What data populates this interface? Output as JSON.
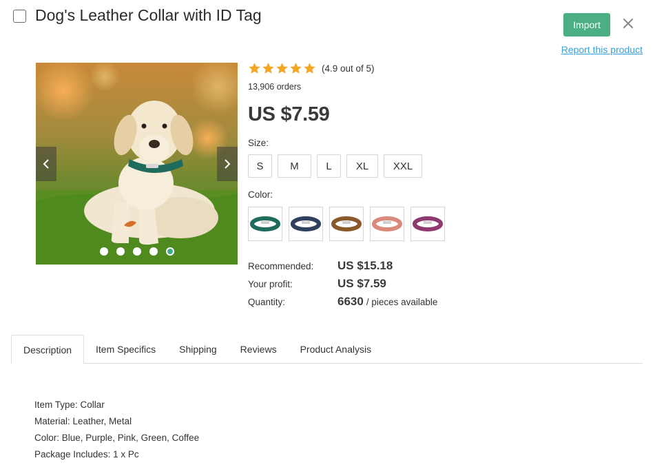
{
  "product": {
    "title": "Dog's Leather Collar with ID Tag",
    "rating_text": "(4.9 out of 5)",
    "rating_value": 4.9,
    "rating_max": 5,
    "orders": "13,906 orders",
    "price": "US $7.59"
  },
  "header": {
    "import_label": "Import",
    "report_label": "Report this product"
  },
  "gallery": {
    "image_count": 5,
    "active_index": 4
  },
  "options": {
    "size_label": "Size:",
    "sizes": [
      "S",
      "M",
      "L",
      "XL",
      "XXL"
    ],
    "color_label": "Color:",
    "colors": [
      {
        "name": "green",
        "hex": "#1f6b5c"
      },
      {
        "name": "blue",
        "hex": "#2f3f5e"
      },
      {
        "name": "coffee",
        "hex": "#8a5a2b"
      },
      {
        "name": "pink",
        "hex": "#d98a7a"
      },
      {
        "name": "purple",
        "hex": "#8e3a6e"
      }
    ]
  },
  "pricing": {
    "recommended_label": "Recommended:",
    "recommended_value": "US $15.18",
    "profit_label": "Your profit:",
    "profit_value": "US $7.59",
    "quantity_label": "Quantity:",
    "quantity_value": "6630",
    "quantity_suffix": "/ pieces available"
  },
  "tabs": [
    "Description",
    "Item Specifics",
    "Shipping",
    "Reviews",
    "Product Analysis"
  ],
  "description": [
    "Item Type: Collar",
    "Material: Leather, Metal",
    "Color: Blue, Purple, Pink, Green, Coffee",
    "Package Includes: 1 x Pc"
  ],
  "theme": {
    "accent": "#4caf83",
    "link": "#3a9fd8",
    "star": "#f5a623"
  }
}
